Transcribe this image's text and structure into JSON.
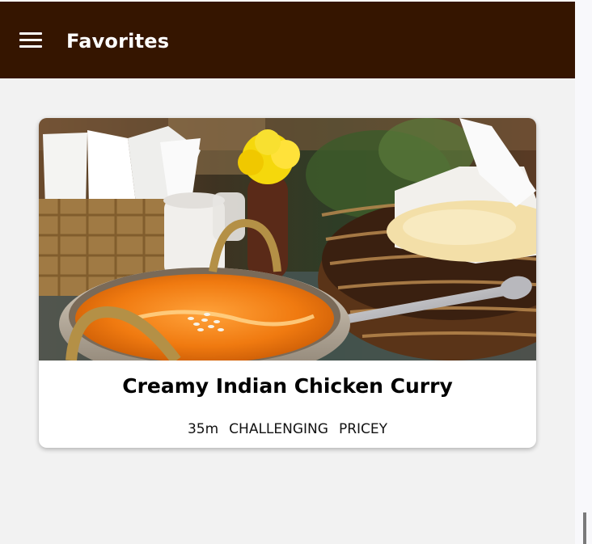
{
  "appbar": {
    "menu_icon": "hamburger-menu-icon",
    "title": "Favorites",
    "background": "#351500"
  },
  "favorites": [
    {
      "title": "Creamy Indian Chicken Curry",
      "duration": "35m",
      "complexity": "CHALLENGING",
      "affordability": "PRICEY"
    }
  ]
}
